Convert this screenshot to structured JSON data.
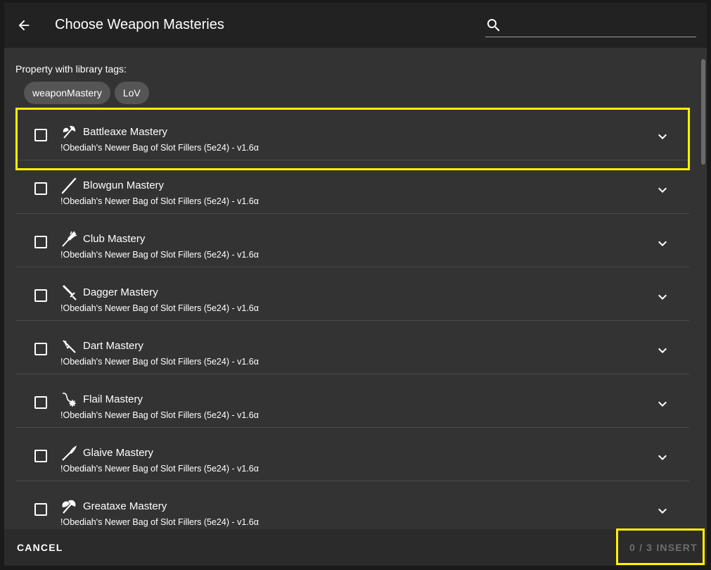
{
  "dialog": {
    "title": "Choose Weapon Masteries",
    "search_placeholder": ""
  },
  "filter": {
    "label": "Property with library tags:",
    "tags": [
      "weaponMastery",
      "LoV"
    ]
  },
  "items": [
    {
      "title": "Battleaxe Mastery",
      "subtitle": "!Obediah's Newer Bag of Slot Fillers (5e24) - v1.6α",
      "icon": "battleaxe-icon"
    },
    {
      "title": "Blowgun Mastery",
      "subtitle": "!Obediah's Newer Bag of Slot Fillers (5e24) - v1.6α",
      "icon": "blowgun-icon"
    },
    {
      "title": "Club Mastery",
      "subtitle": "!Obediah's Newer Bag of Slot Fillers (5e24) - v1.6α",
      "icon": "club-icon"
    },
    {
      "title": "Dagger Mastery",
      "subtitle": "!Obediah's Newer Bag of Slot Fillers (5e24) - v1.6α",
      "icon": "dagger-icon"
    },
    {
      "title": "Dart Mastery",
      "subtitle": "!Obediah's Newer Bag of Slot Fillers (5e24) - v1.6α",
      "icon": "dart-icon"
    },
    {
      "title": "Flail Mastery",
      "subtitle": "!Obediah's Newer Bag of Slot Fillers (5e24) - v1.6α",
      "icon": "flail-icon"
    },
    {
      "title": "Glaive Mastery",
      "subtitle": "!Obediah's Newer Bag of Slot Fillers (5e24) - v1.6α",
      "icon": "glaive-icon"
    },
    {
      "title": "Greataxe Mastery",
      "subtitle": "!Obediah's Newer Bag of Slot Fillers (5e24) - v1.6α",
      "icon": "greataxe-icon"
    }
  ],
  "footer": {
    "cancel_label": "CANCEL",
    "insert_label": "0 / 3 INSERT"
  },
  "colors": {
    "highlight": "#fff200",
    "dialog_bg": "#333333",
    "header_bg": "#222222"
  }
}
